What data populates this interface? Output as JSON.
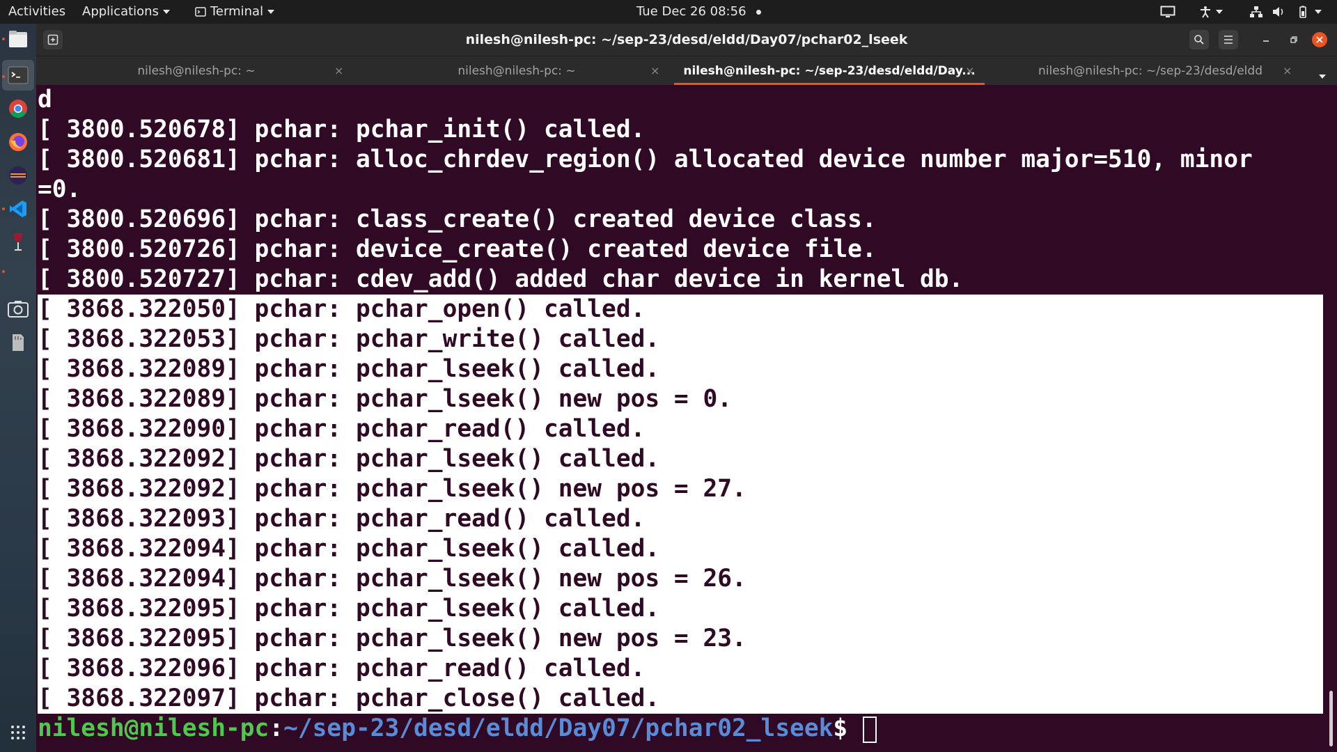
{
  "topbar": {
    "activities": "Activities",
    "applications": "Applications",
    "terminal_menu": "Terminal",
    "clock": "Tue Dec 26  08:56",
    "icons": [
      "screen-icon",
      "accessibility-icon",
      "network-icon",
      "volume-icon",
      "battery-icon",
      "power-menu-icon"
    ]
  },
  "dock": {
    "items": [
      "files-icon",
      "terminal-icon",
      "chrome-icon",
      "firefox-icon",
      "eclipse-icon",
      "vscode-icon",
      "wine-icon",
      "screenshot-icon",
      "sdcard-icon",
      "app-grid-icon"
    ]
  },
  "window": {
    "title": "nilesh@nilesh-pc: ~/sep-23/desd/eldd/Day07/pchar02_lseek",
    "tabs": [
      {
        "label": "nilesh@nilesh-pc: ~",
        "active": false
      },
      {
        "label": "nilesh@nilesh-pc: ~",
        "active": false
      },
      {
        "label": "nilesh@nilesh-pc: ~/sep-23/desd/eldd/Day...",
        "active": true
      },
      {
        "label": "nilesh@nilesh-pc: ~/sep-23/desd/eldd",
        "active": false
      }
    ],
    "tab_close_glyph": "×",
    "accent": "#e95420"
  },
  "terminal": {
    "lines": [
      {
        "text": "d",
        "selected": false
      },
      {
        "text": "[ 3800.520678] pchar: pchar_init() called.",
        "selected": false
      },
      {
        "text": "[ 3800.520681] pchar: alloc_chrdev_region() allocated device number major=510, minor",
        "selected": false
      },
      {
        "text": "=0.",
        "selected": false
      },
      {
        "text": "[ 3800.520696] pchar: class_create() created device class.",
        "selected": false
      },
      {
        "text": "[ 3800.520726] pchar: device_create() created device file.",
        "selected": false
      },
      {
        "text": "[ 3800.520727] pchar: cdev_add() added char device in kernel db.",
        "selected": false
      },
      {
        "text": "[ 3868.322050] pchar: pchar_open() called.",
        "selected": true
      },
      {
        "text": "[ 3868.322053] pchar: pchar_write() called.",
        "selected": true
      },
      {
        "text": "[ 3868.322089] pchar: pchar_lseek() called.",
        "selected": true
      },
      {
        "text": "[ 3868.322089] pchar: pchar_lseek() new pos = 0.",
        "selected": true
      },
      {
        "text": "[ 3868.322090] pchar: pchar_read() called.",
        "selected": true
      },
      {
        "text": "[ 3868.322092] pchar: pchar_lseek() called.",
        "selected": true
      },
      {
        "text": "[ 3868.322092] pchar: pchar_lseek() new pos = 27.",
        "selected": true
      },
      {
        "text": "[ 3868.322093] pchar: pchar_read() called.",
        "selected": true
      },
      {
        "text": "[ 3868.322094] pchar: pchar_lseek() called.",
        "selected": true
      },
      {
        "text": "[ 3868.322094] pchar: pchar_lseek() new pos = 26.",
        "selected": true
      },
      {
        "text": "[ 3868.322095] pchar: pchar_lseek() called.",
        "selected": true
      },
      {
        "text": "[ 3868.322095] pchar: pchar_lseek() new pos = 23.",
        "selected": true
      },
      {
        "text": "[ 3868.322096] pchar: pchar_read() called.",
        "selected": true
      },
      {
        "text": "[ 3868.322097] pchar: pchar_close() called.",
        "selected": true
      }
    ],
    "prompt": {
      "user_host": "nilesh@nilesh-pc",
      "colon": ":",
      "path": "~/sep-23/desd/eldd/Day07/pchar02_lseek",
      "symbol": "$"
    },
    "colors": {
      "background": "#300a24",
      "prompt_user": "#4ec94e",
      "prompt_path": "#5a8bd6",
      "selection": "#ffffff"
    }
  }
}
